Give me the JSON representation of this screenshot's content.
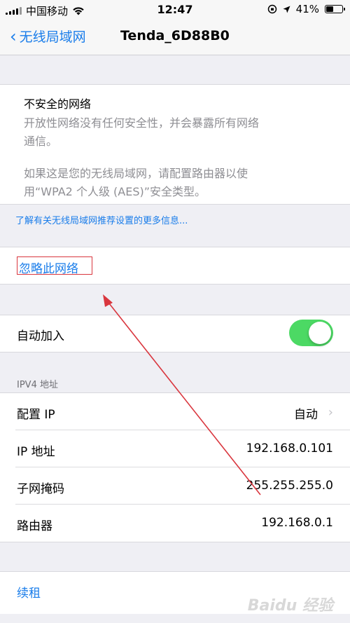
{
  "status_bar": {
    "carrier": "中国移动",
    "time": "12:47",
    "battery": "41%"
  },
  "nav": {
    "back_label": "无线局域网",
    "title": "Tenda_6D88B0"
  },
  "warning": {
    "title": "不安全的网络",
    "body_lines": [
      "开放性网络没有任何安全性，并会暴露所有网络",
      "通信。",
      "如果这是您的无线局域网，请配置路由器以使",
      "用“WPA2 个人级 (AES)”安全类型。"
    ],
    "more_info_link": "了解有关无线局域网推荐设置的更多信息..."
  },
  "forget_network": "忽略此网络",
  "auto_join": {
    "label": "自动加入",
    "enabled": true
  },
  "ipv4": {
    "header": "IPV4 地址",
    "rows": [
      {
        "label": "配置 IP",
        "value": "自动"
      },
      {
        "label": "IP 地址",
        "value": "192.168.0.101"
      },
      {
        "label": "子网掩码",
        "value": "255.255.255.0"
      },
      {
        "label": "路由器",
        "value": "192.168.0.1"
      }
    ]
  },
  "renew_lease": "续租",
  "watermark": "Baidu 经验",
  "colors": {
    "accent": "#1a7dea",
    "toggle_on": "#4cd964",
    "annotation_red": "#d9363e"
  },
  "icons": {
    "signal": "signal-bars-icon",
    "wifi": "wifi-icon",
    "orientation_lock": "orientation-lock-icon",
    "location": "location-arrow-icon",
    "battery": "battery-icon",
    "back": "chevron-left-icon",
    "disclosure": "chevron-right-icon",
    "annotation": "red-arrow-annotation"
  }
}
